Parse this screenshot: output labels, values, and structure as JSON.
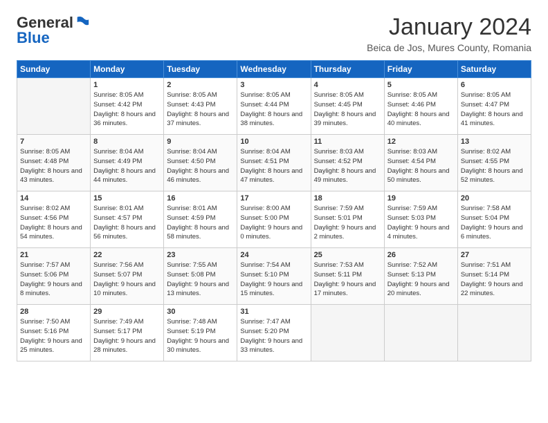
{
  "header": {
    "logo_line1": "General",
    "logo_line2": "Blue",
    "month_title": "January 2024",
    "location": "Beica de Jos, Mures County, Romania"
  },
  "days_of_week": [
    "Sunday",
    "Monday",
    "Tuesday",
    "Wednesday",
    "Thursday",
    "Friday",
    "Saturday"
  ],
  "weeks": [
    [
      {
        "num": "",
        "empty": true
      },
      {
        "num": "1",
        "sunrise": "8:05 AM",
        "sunset": "4:42 PM",
        "daylight": "8 hours and 36 minutes."
      },
      {
        "num": "2",
        "sunrise": "8:05 AM",
        "sunset": "4:43 PM",
        "daylight": "8 hours and 37 minutes."
      },
      {
        "num": "3",
        "sunrise": "8:05 AM",
        "sunset": "4:44 PM",
        "daylight": "8 hours and 38 minutes."
      },
      {
        "num": "4",
        "sunrise": "8:05 AM",
        "sunset": "4:45 PM",
        "daylight": "8 hours and 39 minutes."
      },
      {
        "num": "5",
        "sunrise": "8:05 AM",
        "sunset": "4:46 PM",
        "daylight": "8 hours and 40 minutes."
      },
      {
        "num": "6",
        "sunrise": "8:05 AM",
        "sunset": "4:47 PM",
        "daylight": "8 hours and 41 minutes."
      }
    ],
    [
      {
        "num": "7",
        "sunrise": "8:05 AM",
        "sunset": "4:48 PM",
        "daylight": "8 hours and 43 minutes."
      },
      {
        "num": "8",
        "sunrise": "8:04 AM",
        "sunset": "4:49 PM",
        "daylight": "8 hours and 44 minutes."
      },
      {
        "num": "9",
        "sunrise": "8:04 AM",
        "sunset": "4:50 PM",
        "daylight": "8 hours and 46 minutes."
      },
      {
        "num": "10",
        "sunrise": "8:04 AM",
        "sunset": "4:51 PM",
        "daylight": "8 hours and 47 minutes."
      },
      {
        "num": "11",
        "sunrise": "8:03 AM",
        "sunset": "4:52 PM",
        "daylight": "8 hours and 49 minutes."
      },
      {
        "num": "12",
        "sunrise": "8:03 AM",
        "sunset": "4:54 PM",
        "daylight": "8 hours and 50 minutes."
      },
      {
        "num": "13",
        "sunrise": "8:02 AM",
        "sunset": "4:55 PM",
        "daylight": "8 hours and 52 minutes."
      }
    ],
    [
      {
        "num": "14",
        "sunrise": "8:02 AM",
        "sunset": "4:56 PM",
        "daylight": "8 hours and 54 minutes."
      },
      {
        "num": "15",
        "sunrise": "8:01 AM",
        "sunset": "4:57 PM",
        "daylight": "8 hours and 56 minutes."
      },
      {
        "num": "16",
        "sunrise": "8:01 AM",
        "sunset": "4:59 PM",
        "daylight": "8 hours and 58 minutes."
      },
      {
        "num": "17",
        "sunrise": "8:00 AM",
        "sunset": "5:00 PM",
        "daylight": "9 hours and 0 minutes."
      },
      {
        "num": "18",
        "sunrise": "7:59 AM",
        "sunset": "5:01 PM",
        "daylight": "9 hours and 2 minutes."
      },
      {
        "num": "19",
        "sunrise": "7:59 AM",
        "sunset": "5:03 PM",
        "daylight": "9 hours and 4 minutes."
      },
      {
        "num": "20",
        "sunrise": "7:58 AM",
        "sunset": "5:04 PM",
        "daylight": "9 hours and 6 minutes."
      }
    ],
    [
      {
        "num": "21",
        "sunrise": "7:57 AM",
        "sunset": "5:06 PM",
        "daylight": "9 hours and 8 minutes."
      },
      {
        "num": "22",
        "sunrise": "7:56 AM",
        "sunset": "5:07 PM",
        "daylight": "9 hours and 10 minutes."
      },
      {
        "num": "23",
        "sunrise": "7:55 AM",
        "sunset": "5:08 PM",
        "daylight": "9 hours and 13 minutes."
      },
      {
        "num": "24",
        "sunrise": "7:54 AM",
        "sunset": "5:10 PM",
        "daylight": "9 hours and 15 minutes."
      },
      {
        "num": "25",
        "sunrise": "7:53 AM",
        "sunset": "5:11 PM",
        "daylight": "9 hours and 17 minutes."
      },
      {
        "num": "26",
        "sunrise": "7:52 AM",
        "sunset": "5:13 PM",
        "daylight": "9 hours and 20 minutes."
      },
      {
        "num": "27",
        "sunrise": "7:51 AM",
        "sunset": "5:14 PM",
        "daylight": "9 hours and 22 minutes."
      }
    ],
    [
      {
        "num": "28",
        "sunrise": "7:50 AM",
        "sunset": "5:16 PM",
        "daylight": "9 hours and 25 minutes."
      },
      {
        "num": "29",
        "sunrise": "7:49 AM",
        "sunset": "5:17 PM",
        "daylight": "9 hours and 28 minutes."
      },
      {
        "num": "30",
        "sunrise": "7:48 AM",
        "sunset": "5:19 PM",
        "daylight": "9 hours and 30 minutes."
      },
      {
        "num": "31",
        "sunrise": "7:47 AM",
        "sunset": "5:20 PM",
        "daylight": "9 hours and 33 minutes."
      },
      {
        "num": "",
        "empty": true
      },
      {
        "num": "",
        "empty": true
      },
      {
        "num": "",
        "empty": true
      }
    ]
  ]
}
